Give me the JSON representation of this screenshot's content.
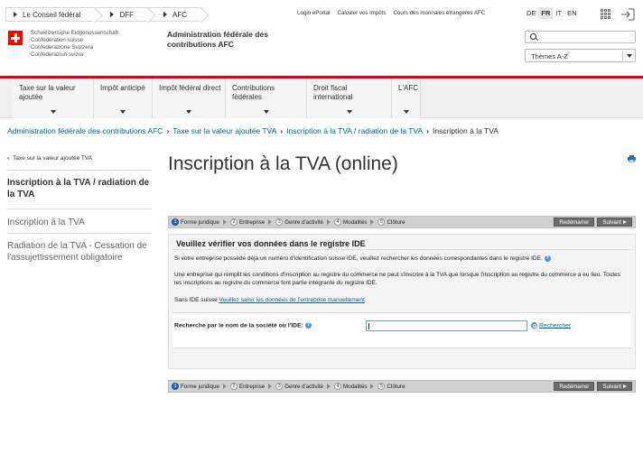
{
  "topbar": {
    "crumbs": [
      "Le Conseil fédéral",
      "DFF",
      "AFC"
    ],
    "links": [
      "Login ePortal",
      "Calculer vos impôts",
      "Cours des monnaies étrangères AFC"
    ],
    "languages": [
      "DE",
      "FR",
      "IT",
      "EN"
    ],
    "active_language": "FR"
  },
  "header": {
    "confederation": [
      "Schweizerische Eidgenossenschaft",
      "Confédération suisse",
      "Confederazione Svizzera",
      "Confederaziun svizra"
    ],
    "admin_title_1": "Administration fédérale des",
    "admin_title_2": "contributions AFC",
    "search_placeholder": "",
    "themes_label": "Thèmes A-Z"
  },
  "nav": {
    "items": [
      {
        "line1": "Taxe sur la valeur",
        "line2": "ajoutée"
      },
      {
        "line1": "Impôt anticipé",
        "line2": ""
      },
      {
        "line1": "Impôt fédéral direct",
        "line2": ""
      },
      {
        "line1": "Contributions",
        "line2": "fédérales"
      },
      {
        "line1": "Droit fiscal",
        "line2": "international"
      },
      {
        "line1": "L'AFC",
        "line2": ""
      }
    ]
  },
  "breadcrumb": {
    "items": [
      "Administration fédérale des contributions AFC",
      "Taxe sur la valeur ajoutée TVA",
      "Inscription à la TVA / radiation de la TVA"
    ],
    "current": "Inscription à la TVA"
  },
  "sidebar": {
    "back": "Taxe sur la valeur ajoutée TVA",
    "active": "Inscription à la TVA / radiation de la TVA",
    "items": [
      "Inscription à la TVA",
      "Radiation de la TVA - Cessation de l'assujettissement obligatoire"
    ]
  },
  "main": {
    "title": "Inscription à la TVA (online)",
    "steps": [
      {
        "num": "1",
        "label": "Forme juridique"
      },
      {
        "num": "2",
        "label": "Entreprise"
      },
      {
        "num": "3",
        "label": "Genre d'activité"
      },
      {
        "num": "4",
        "label": "Modalités"
      },
      {
        "num": "5",
        "label": "Clôture"
      }
    ],
    "restart_label": "Redémarrer",
    "next_label": "Suivant",
    "legend": "Veuillez vérifier vos données dans le registre IDE",
    "para1": "Si votre entreprise possède déjà un numéro d'identification suisse IDE, veuillez rechercher les données correspondantes dans le registre IDE.",
    "para2": "Une entreprise qui remplit les conditions d'inscription au registre du commerce ne peut s'inscrire à la TVA que lorsque l'inscription au registre du commerce a eu lieu. Toutes les inscriptions au registre du commerce font partie intégrante du registre IDE.",
    "para3_prefix": "Sans IDE suisse",
    "para3_link": "Veuillez saisir les données de l'entreprise manuellement",
    "search_label": "Recherche par le nom de la société ou l'IDE:",
    "search_value": "",
    "search_button": "Rechercher"
  }
}
